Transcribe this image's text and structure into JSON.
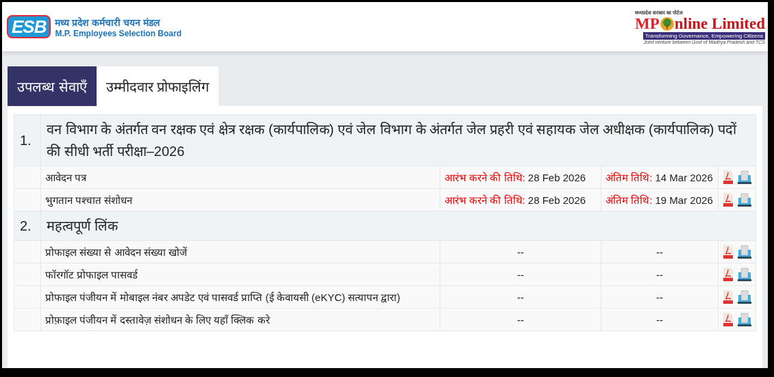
{
  "header": {
    "esb_logo": {
      "mark": "ESB",
      "title_hi": "मध्य प्रदेश कर्मचारी चयन मंडल",
      "title_en": "M.P. Employees Selection Board"
    },
    "mponline_logo": {
      "top": "मध्यप्रदेश सरकार का पोर्टल",
      "mp": "MP",
      "name": "nline Limited",
      "tagline": "Transforming Governance, Empowering Citizens",
      "note": "Joint venture between Govt of Madhya Pradesh and TCS"
    }
  },
  "tabs": [
    {
      "label": "उपलब्ध सेवाएँ",
      "selected": true
    },
    {
      "label": "उम्मीदवार प्रोफाइलिंग",
      "selected": false
    }
  ],
  "sections": [
    {
      "number": "1.",
      "title": "वन विभाग के अंतर्गत वन रक्षक एवं क्षेत्र रक्षक (कार्यपालिक) एवं जेल विभाग के अंतर्गत जेल प्रहरी एवं सहायक जेल अधीक्षक (कार्यपालिक) पदों की सीधी भर्ती परीक्षा–2026",
      "rows": [
        {
          "name": "आवेदन पत्र",
          "start_label": "आरंभ करने की तिथि:",
          "start_date": "28 Feb 2026",
          "end_label": "अंतिम तिथि:",
          "end_date": "14 Mar 2026"
        },
        {
          "name": "भुगतान पश्चात संशोधन",
          "start_label": "आरंभ करने की तिथि:",
          "start_date": "28 Feb 2026",
          "end_label": "अंतिम तिथि:",
          "end_date": "19 Mar 2026"
        }
      ]
    },
    {
      "number": "2.",
      "title": "महत्वपूर्ण लिंक",
      "rows": [
        {
          "name": "प्रोफाइल संख्या से आवेदन संख्या खोजें",
          "start_date": "--",
          "end_date": "--"
        },
        {
          "name": "फॉरगॉट प्रोफाइल पासवर्ड",
          "start_date": "--",
          "end_date": "--"
        },
        {
          "name": "प्रोफाइल पंजीयन में मोबाइल नंबर अपडेट एवं पासवर्ड प्राप्ति (ई केवायसी (eKYC) सत्यापन द्वारा)",
          "start_date": "--",
          "end_date": "--"
        },
        {
          "name": "प्रोफ़ाइल पंजीयन में दस्तावेज़ संशोधन के लिए यहाँ क्लिक करे",
          "start_date": "--",
          "end_date": "--"
        }
      ]
    }
  ]
}
